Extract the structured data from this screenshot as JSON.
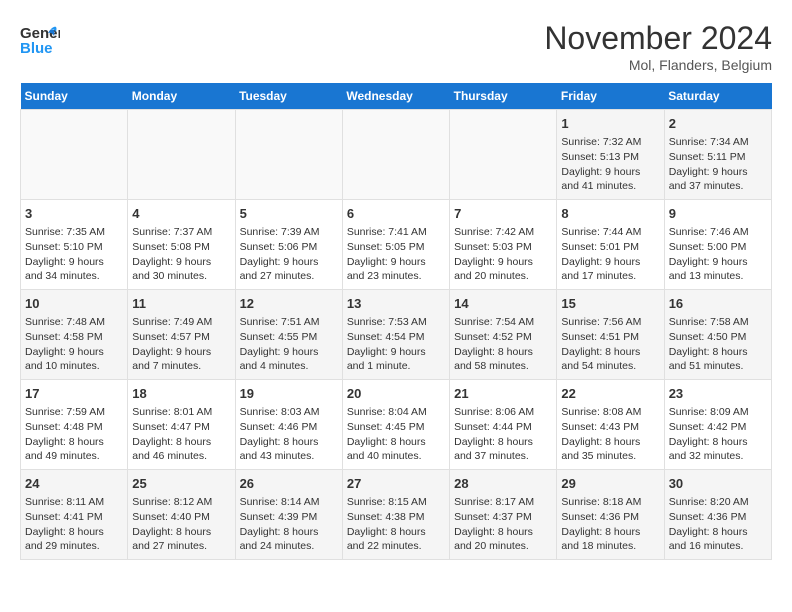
{
  "header": {
    "logo_line1": "General",
    "logo_line2": "Blue",
    "title": "November 2024",
    "location": "Mol, Flanders, Belgium"
  },
  "days_of_week": [
    "Sunday",
    "Monday",
    "Tuesday",
    "Wednesday",
    "Thursday",
    "Friday",
    "Saturday"
  ],
  "weeks": [
    [
      {
        "day": "",
        "sunrise": "",
        "sunset": "",
        "daylight": "",
        "empty": true
      },
      {
        "day": "",
        "sunrise": "",
        "sunset": "",
        "daylight": "",
        "empty": true
      },
      {
        "day": "",
        "sunrise": "",
        "sunset": "",
        "daylight": "",
        "empty": true
      },
      {
        "day": "",
        "sunrise": "",
        "sunset": "",
        "daylight": "",
        "empty": true
      },
      {
        "day": "",
        "sunrise": "",
        "sunset": "",
        "daylight": "",
        "empty": true
      },
      {
        "day": "1",
        "sunrise": "Sunrise: 7:32 AM",
        "sunset": "Sunset: 5:13 PM",
        "daylight": "Daylight: 9 hours and 41 minutes.",
        "empty": false
      },
      {
        "day": "2",
        "sunrise": "Sunrise: 7:34 AM",
        "sunset": "Sunset: 5:11 PM",
        "daylight": "Daylight: 9 hours and 37 minutes.",
        "empty": false
      }
    ],
    [
      {
        "day": "3",
        "sunrise": "Sunrise: 7:35 AM",
        "sunset": "Sunset: 5:10 PM",
        "daylight": "Daylight: 9 hours and 34 minutes.",
        "empty": false
      },
      {
        "day": "4",
        "sunrise": "Sunrise: 7:37 AM",
        "sunset": "Sunset: 5:08 PM",
        "daylight": "Daylight: 9 hours and 30 minutes.",
        "empty": false
      },
      {
        "day": "5",
        "sunrise": "Sunrise: 7:39 AM",
        "sunset": "Sunset: 5:06 PM",
        "daylight": "Daylight: 9 hours and 27 minutes.",
        "empty": false
      },
      {
        "day": "6",
        "sunrise": "Sunrise: 7:41 AM",
        "sunset": "Sunset: 5:05 PM",
        "daylight": "Daylight: 9 hours and 23 minutes.",
        "empty": false
      },
      {
        "day": "7",
        "sunrise": "Sunrise: 7:42 AM",
        "sunset": "Sunset: 5:03 PM",
        "daylight": "Daylight: 9 hours and 20 minutes.",
        "empty": false
      },
      {
        "day": "8",
        "sunrise": "Sunrise: 7:44 AM",
        "sunset": "Sunset: 5:01 PM",
        "daylight": "Daylight: 9 hours and 17 minutes.",
        "empty": false
      },
      {
        "day": "9",
        "sunrise": "Sunrise: 7:46 AM",
        "sunset": "Sunset: 5:00 PM",
        "daylight": "Daylight: 9 hours and 13 minutes.",
        "empty": false
      }
    ],
    [
      {
        "day": "10",
        "sunrise": "Sunrise: 7:48 AM",
        "sunset": "Sunset: 4:58 PM",
        "daylight": "Daylight: 9 hours and 10 minutes.",
        "empty": false
      },
      {
        "day": "11",
        "sunrise": "Sunrise: 7:49 AM",
        "sunset": "Sunset: 4:57 PM",
        "daylight": "Daylight: 9 hours and 7 minutes.",
        "empty": false
      },
      {
        "day": "12",
        "sunrise": "Sunrise: 7:51 AM",
        "sunset": "Sunset: 4:55 PM",
        "daylight": "Daylight: 9 hours and 4 minutes.",
        "empty": false
      },
      {
        "day": "13",
        "sunrise": "Sunrise: 7:53 AM",
        "sunset": "Sunset: 4:54 PM",
        "daylight": "Daylight: 9 hours and 1 minute.",
        "empty": false
      },
      {
        "day": "14",
        "sunrise": "Sunrise: 7:54 AM",
        "sunset": "Sunset: 4:52 PM",
        "daylight": "Daylight: 8 hours and 58 minutes.",
        "empty": false
      },
      {
        "day": "15",
        "sunrise": "Sunrise: 7:56 AM",
        "sunset": "Sunset: 4:51 PM",
        "daylight": "Daylight: 8 hours and 54 minutes.",
        "empty": false
      },
      {
        "day": "16",
        "sunrise": "Sunrise: 7:58 AM",
        "sunset": "Sunset: 4:50 PM",
        "daylight": "Daylight: 8 hours and 51 minutes.",
        "empty": false
      }
    ],
    [
      {
        "day": "17",
        "sunrise": "Sunrise: 7:59 AM",
        "sunset": "Sunset: 4:48 PM",
        "daylight": "Daylight: 8 hours and 49 minutes.",
        "empty": false
      },
      {
        "day": "18",
        "sunrise": "Sunrise: 8:01 AM",
        "sunset": "Sunset: 4:47 PM",
        "daylight": "Daylight: 8 hours and 46 minutes.",
        "empty": false
      },
      {
        "day": "19",
        "sunrise": "Sunrise: 8:03 AM",
        "sunset": "Sunset: 4:46 PM",
        "daylight": "Daylight: 8 hours and 43 minutes.",
        "empty": false
      },
      {
        "day": "20",
        "sunrise": "Sunrise: 8:04 AM",
        "sunset": "Sunset: 4:45 PM",
        "daylight": "Daylight: 8 hours and 40 minutes.",
        "empty": false
      },
      {
        "day": "21",
        "sunrise": "Sunrise: 8:06 AM",
        "sunset": "Sunset: 4:44 PM",
        "daylight": "Daylight: 8 hours and 37 minutes.",
        "empty": false
      },
      {
        "day": "22",
        "sunrise": "Sunrise: 8:08 AM",
        "sunset": "Sunset: 4:43 PM",
        "daylight": "Daylight: 8 hours and 35 minutes.",
        "empty": false
      },
      {
        "day": "23",
        "sunrise": "Sunrise: 8:09 AM",
        "sunset": "Sunset: 4:42 PM",
        "daylight": "Daylight: 8 hours and 32 minutes.",
        "empty": false
      }
    ],
    [
      {
        "day": "24",
        "sunrise": "Sunrise: 8:11 AM",
        "sunset": "Sunset: 4:41 PM",
        "daylight": "Daylight: 8 hours and 29 minutes.",
        "empty": false
      },
      {
        "day": "25",
        "sunrise": "Sunrise: 8:12 AM",
        "sunset": "Sunset: 4:40 PM",
        "daylight": "Daylight: 8 hours and 27 minutes.",
        "empty": false
      },
      {
        "day": "26",
        "sunrise": "Sunrise: 8:14 AM",
        "sunset": "Sunset: 4:39 PM",
        "daylight": "Daylight: 8 hours and 24 minutes.",
        "empty": false
      },
      {
        "day": "27",
        "sunrise": "Sunrise: 8:15 AM",
        "sunset": "Sunset: 4:38 PM",
        "daylight": "Daylight: 8 hours and 22 minutes.",
        "empty": false
      },
      {
        "day": "28",
        "sunrise": "Sunrise: 8:17 AM",
        "sunset": "Sunset: 4:37 PM",
        "daylight": "Daylight: 8 hours and 20 minutes.",
        "empty": false
      },
      {
        "day": "29",
        "sunrise": "Sunrise: 8:18 AM",
        "sunset": "Sunset: 4:36 PM",
        "daylight": "Daylight: 8 hours and 18 minutes.",
        "empty": false
      },
      {
        "day": "30",
        "sunrise": "Sunrise: 8:20 AM",
        "sunset": "Sunset: 4:36 PM",
        "daylight": "Daylight: 8 hours and 16 minutes.",
        "empty": false
      }
    ]
  ]
}
